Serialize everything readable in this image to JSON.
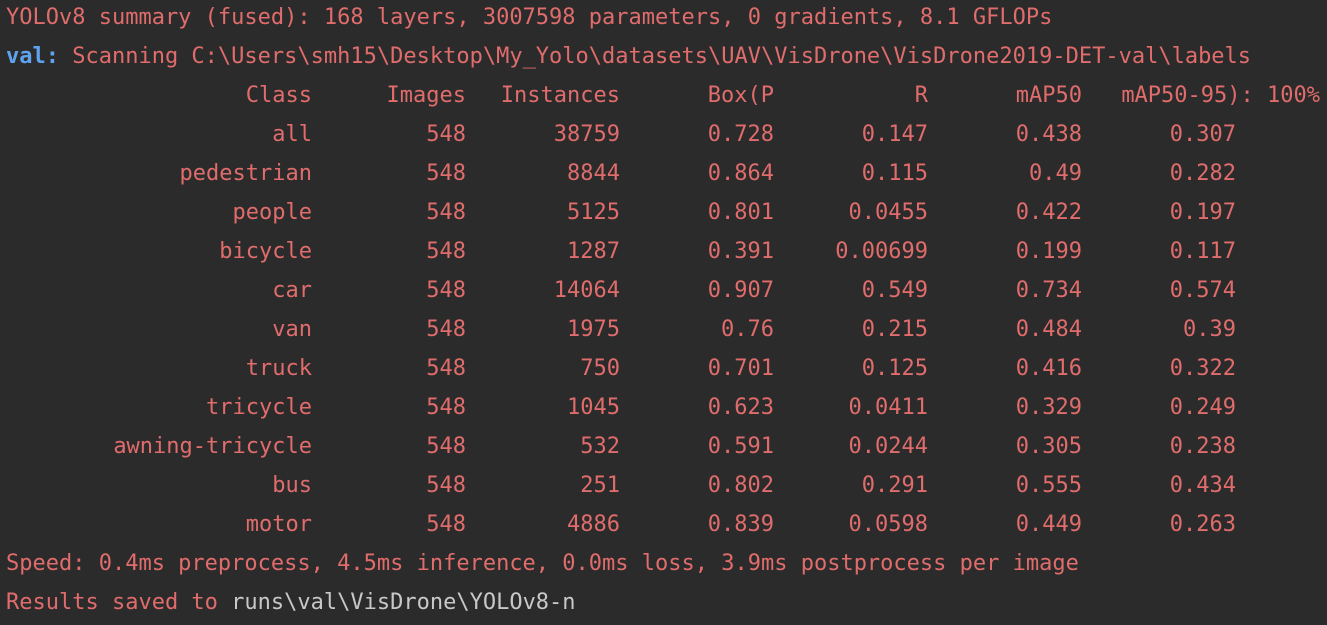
{
  "summary_line": "YOLOv8 summary (fused): 168 layers, 3007598 parameters, 0 gradients, 8.1 GFLOPs",
  "scan": {
    "label": "val:",
    "text": " Scanning C:\\Users\\smh15\\Desktop\\My_Yolo\\datasets\\UAV\\VisDrone\\VisDrone2019-DET-val\\labels"
  },
  "table": {
    "headers": [
      "Class",
      "Images",
      "Instances",
      "Box(P",
      "R",
      "mAP50",
      "mAP50-95): 100%"
    ],
    "rows": [
      [
        "all",
        "548",
        "38759",
        "0.728",
        "0.147",
        "0.438",
        "0.307"
      ],
      [
        "pedestrian",
        "548",
        "8844",
        "0.864",
        "0.115",
        "0.49",
        "0.282"
      ],
      [
        "people",
        "548",
        "5125",
        "0.801",
        "0.0455",
        "0.422",
        "0.197"
      ],
      [
        "bicycle",
        "548",
        "1287",
        "0.391",
        "0.00699",
        "0.199",
        "0.117"
      ],
      [
        "car",
        "548",
        "14064",
        "0.907",
        "0.549",
        "0.734",
        "0.574"
      ],
      [
        "van",
        "548",
        "1975",
        "0.76",
        "0.215",
        "0.484",
        "0.39"
      ],
      [
        "truck",
        "548",
        "750",
        "0.701",
        "0.125",
        "0.416",
        "0.322"
      ],
      [
        "tricycle",
        "548",
        "1045",
        "0.623",
        "0.0411",
        "0.329",
        "0.249"
      ],
      [
        "awning-tricycle",
        "548",
        "532",
        "0.591",
        "0.0244",
        "0.305",
        "0.238"
      ],
      [
        "bus",
        "548",
        "251",
        "0.802",
        "0.291",
        "0.555",
        "0.434"
      ],
      [
        "motor",
        "548",
        "4886",
        "0.839",
        "0.0598",
        "0.449",
        "0.263"
      ]
    ]
  },
  "speed_line": "Speed: 0.4ms preprocess, 4.5ms inference, 0.0ms loss, 3.9ms postprocess per image",
  "results": {
    "prefix": "Results saved to ",
    "path": "runs\\val\\VisDrone\\YOLOv8-n"
  },
  "colors": {
    "background": "#2b2b2b",
    "text": "#e06c6c",
    "val_label": "#5fa3f0",
    "path": "#c8c8c8"
  }
}
